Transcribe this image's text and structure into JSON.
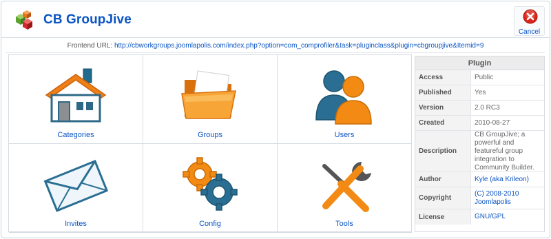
{
  "header": {
    "title": "CB GroupJive",
    "logo_icon": "colored-cubes-icon",
    "cancel_label": "Cancel",
    "cancel_icon": "red-x-circle-icon"
  },
  "frontend": {
    "label": "Frontend URL:",
    "url": "http://cbworkgroups.joomlapolis.com/index.php?option=com_comprofiler&task=pluginclass&plugin=cbgroupjive&Itemid=9"
  },
  "menu": [
    {
      "label": "Categories",
      "icon": "house-icon"
    },
    {
      "label": "Groups",
      "icon": "folder-icon"
    },
    {
      "label": "Users",
      "icon": "users-icon"
    },
    {
      "label": "Invites",
      "icon": "envelope-icon"
    },
    {
      "label": "Config",
      "icon": "gears-icon"
    },
    {
      "label": "Tools",
      "icon": "tools-icon"
    }
  ],
  "plugin": {
    "heading": "Plugin",
    "access": {
      "key": "Access",
      "value": "Public"
    },
    "published": {
      "key": "Published",
      "value": "Yes"
    },
    "version": {
      "key": "Version",
      "value": "2.0 RC3"
    },
    "created": {
      "key": "Created",
      "value": "2010-08-27"
    },
    "description": {
      "key": "Description",
      "value": "CB GroupJive; a powerful and featureful group integration to Community Builder."
    },
    "author": {
      "key": "Author",
      "value": "Kyle (aka Krileon)"
    },
    "copyright": {
      "key": "Copyright",
      "value": "(C) 2008-2010 Joomlapolis"
    },
    "license": {
      "key": "License",
      "value": "GNU/GPL"
    }
  },
  "colors": {
    "link": "#0b55c4",
    "accent_orange": "#f28a14",
    "accent_blue": "#2a6f93",
    "cancel_red": "#d9261c"
  }
}
